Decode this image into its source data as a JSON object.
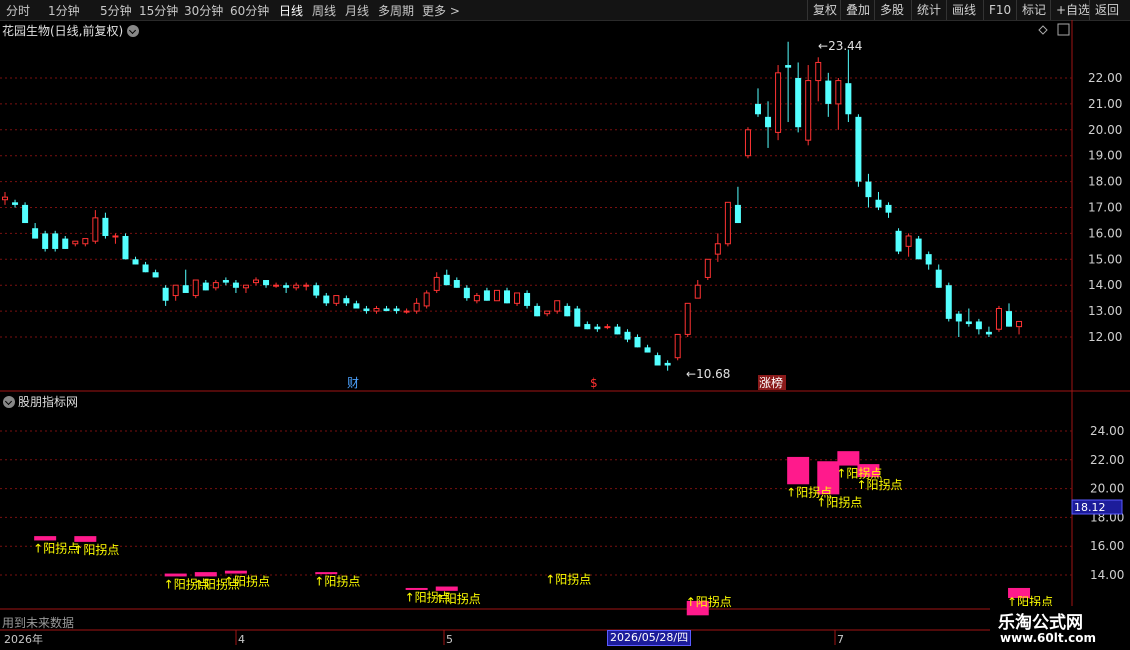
{
  "toolbar": {
    "periods": [
      "分时",
      "1分钟",
      "5分钟",
      "15分钟",
      "30分钟",
      "60分钟",
      "日线",
      "周线",
      "月线",
      "多周期",
      "更多 >"
    ],
    "active_period": "日线",
    "buttons": [
      "复权",
      "叠加",
      "多股",
      "统计",
      "画线",
      "F10",
      "标记",
      "+自选",
      "返回"
    ]
  },
  "main_chart": {
    "title": "花园生物(日线,前复权)",
    "high_label": "23.44",
    "low_label": "10.68",
    "price_ticks": [
      "22.00",
      "21.00",
      "20.00",
      "19.00",
      "18.00",
      "17.00",
      "16.00",
      "15.00",
      "14.00",
      "13.00",
      "12.00"
    ],
    "markers": [
      {
        "text": "财",
        "color": "#4da3ff"
      },
      {
        "text": "$",
        "color": "#ff3030"
      },
      {
        "text": "涨榜",
        "color": "#ffffff",
        "bg": "#8a1a1a"
      }
    ]
  },
  "sub_chart": {
    "title": "股朋指标网",
    "price_ticks": [
      "24.00",
      "22.00",
      "20.00",
      "18.00",
      "16.00",
      "14.00"
    ],
    "current_value": "18.12",
    "signal_label": "↑阳拐点",
    "note": "用到未来数据"
  },
  "time_axis": {
    "labels": [
      "2026年",
      "4",
      "5",
      "7"
    ],
    "cursor_date": "2026/05/28/四"
  },
  "watermark": {
    "line1": "乐淘公式网",
    "line2": "www.60lt.com"
  },
  "colors": {
    "up": "#ff3333",
    "down": "#54ffff",
    "grid": "#7a1010",
    "signal_box": "#ff1a8c",
    "signal_text": "#ffff00"
  },
  "chart_data": {
    "type": "candlestick",
    "ylim": [
      10.0,
      24.0
    ],
    "candles": [
      {
        "o": 17.3,
        "h": 17.6,
        "l": 17.1,
        "c": 17.4
      },
      {
        "o": 17.2,
        "h": 17.3,
        "l": 17.0,
        "c": 17.1
      },
      {
        "o": 17.1,
        "h": 17.2,
        "l": 16.4,
        "c": 16.4
      },
      {
        "o": 16.2,
        "h": 16.4,
        "l": 15.8,
        "c": 15.8
      },
      {
        "o": 16.0,
        "h": 16.1,
        "l": 15.3,
        "c": 15.4
      },
      {
        "o": 16.0,
        "h": 16.1,
        "l": 15.3,
        "c": 15.4
      },
      {
        "o": 15.8,
        "h": 15.9,
        "l": 15.4,
        "c": 15.4
      },
      {
        "o": 15.6,
        "h": 15.7,
        "l": 15.5,
        "c": 15.7
      },
      {
        "o": 15.6,
        "h": 15.8,
        "l": 15.5,
        "c": 15.8
      },
      {
        "o": 15.7,
        "h": 16.9,
        "l": 15.6,
        "c": 16.6
      },
      {
        "o": 16.6,
        "h": 16.8,
        "l": 15.8,
        "c": 15.9
      },
      {
        "o": 15.9,
        "h": 16.0,
        "l": 15.6,
        "c": 15.9
      },
      {
        "o": 15.9,
        "h": 16.0,
        "l": 15.0,
        "c": 15.0
      },
      {
        "o": 15.0,
        "h": 15.1,
        "l": 14.8,
        "c": 14.8
      },
      {
        "o": 14.8,
        "h": 14.9,
        "l": 14.5,
        "c": 14.5
      },
      {
        "o": 14.5,
        "h": 14.6,
        "l": 14.3,
        "c": 14.3
      },
      {
        "o": 13.9,
        "h": 14.0,
        "l": 13.2,
        "c": 13.4
      },
      {
        "o": 13.6,
        "h": 14.0,
        "l": 13.4,
        "c": 14.0
      },
      {
        "o": 14.0,
        "h": 14.6,
        "l": 13.8,
        "c": 13.7
      },
      {
        "o": 13.6,
        "h": 14.2,
        "l": 13.5,
        "c": 14.2
      },
      {
        "o": 14.1,
        "h": 14.2,
        "l": 13.8,
        "c": 13.8
      },
      {
        "o": 13.9,
        "h": 14.2,
        "l": 13.8,
        "c": 14.1
      },
      {
        "o": 14.2,
        "h": 14.3,
        "l": 14.0,
        "c": 14.1
      },
      {
        "o": 14.1,
        "h": 14.2,
        "l": 13.7,
        "c": 13.9
      },
      {
        "o": 13.9,
        "h": 14.0,
        "l": 13.7,
        "c": 14.0
      },
      {
        "o": 14.1,
        "h": 14.3,
        "l": 14.0,
        "c": 14.2
      },
      {
        "o": 14.2,
        "h": 14.2,
        "l": 13.9,
        "c": 14.0
      },
      {
        "o": 14.0,
        "h": 14.1,
        "l": 13.9,
        "c": 14.0
      },
      {
        "o": 14.0,
        "h": 14.1,
        "l": 13.7,
        "c": 13.9
      },
      {
        "o": 13.9,
        "h": 14.1,
        "l": 13.8,
        "c": 14.0
      },
      {
        "o": 14.0,
        "h": 14.1,
        "l": 13.8,
        "c": 14.0
      },
      {
        "o": 14.0,
        "h": 14.1,
        "l": 13.5,
        "c": 13.6
      },
      {
        "o": 13.6,
        "h": 13.7,
        "l": 13.2,
        "c": 13.3
      },
      {
        "o": 13.3,
        "h": 13.6,
        "l": 13.2,
        "c": 13.6
      },
      {
        "o": 13.5,
        "h": 13.6,
        "l": 13.2,
        "c": 13.3
      },
      {
        "o": 13.3,
        "h": 13.4,
        "l": 13.1,
        "c": 13.1
      },
      {
        "o": 13.1,
        "h": 13.2,
        "l": 12.9,
        "c": 13.0
      },
      {
        "o": 13.0,
        "h": 13.2,
        "l": 12.9,
        "c": 13.1
      },
      {
        "o": 13.1,
        "h": 13.2,
        "l": 13.0,
        "c": 13.0
      },
      {
        "o": 13.1,
        "h": 13.2,
        "l": 12.9,
        "c": 13.0
      },
      {
        "o": 13.0,
        "h": 13.1,
        "l": 12.9,
        "c": 13.0
      },
      {
        "o": 13.0,
        "h": 13.5,
        "l": 12.9,
        "c": 13.3
      },
      {
        "o": 13.2,
        "h": 13.8,
        "l": 13.1,
        "c": 13.7
      },
      {
        "o": 13.8,
        "h": 14.5,
        "l": 13.7,
        "c": 14.3
      },
      {
        "o": 14.4,
        "h": 14.6,
        "l": 14.0,
        "c": 14.0
      },
      {
        "o": 14.2,
        "h": 14.3,
        "l": 13.9,
        "c": 13.9
      },
      {
        "o": 13.9,
        "h": 14.0,
        "l": 13.4,
        "c": 13.5
      },
      {
        "o": 13.4,
        "h": 13.7,
        "l": 13.3,
        "c": 13.6
      },
      {
        "o": 13.8,
        "h": 13.9,
        "l": 13.4,
        "c": 13.4
      },
      {
        "o": 13.4,
        "h": 13.8,
        "l": 13.4,
        "c": 13.8
      },
      {
        "o": 13.8,
        "h": 13.9,
        "l": 13.3,
        "c": 13.3
      },
      {
        "o": 13.3,
        "h": 13.7,
        "l": 13.2,
        "c": 13.7
      },
      {
        "o": 13.7,
        "h": 13.8,
        "l": 13.1,
        "c": 13.2
      },
      {
        "o": 13.2,
        "h": 13.3,
        "l": 12.8,
        "c": 12.8
      },
      {
        "o": 12.9,
        "h": 13.0,
        "l": 12.8,
        "c": 13.0
      },
      {
        "o": 13.0,
        "h": 13.4,
        "l": 12.9,
        "c": 13.4
      },
      {
        "o": 13.2,
        "h": 13.3,
        "l": 12.8,
        "c": 12.8
      },
      {
        "o": 13.1,
        "h": 13.2,
        "l": 12.4,
        "c": 12.4
      },
      {
        "o": 12.5,
        "h": 12.6,
        "l": 12.3,
        "c": 12.3
      },
      {
        "o": 12.4,
        "h": 12.5,
        "l": 12.2,
        "c": 12.3
      },
      {
        "o": 12.4,
        "h": 12.5,
        "l": 12.3,
        "c": 12.4
      },
      {
        "o": 12.4,
        "h": 12.5,
        "l": 12.1,
        "c": 12.1
      },
      {
        "o": 12.2,
        "h": 12.3,
        "l": 11.8,
        "c": 11.9
      },
      {
        "o": 12.0,
        "h": 12.1,
        "l": 11.6,
        "c": 11.6
      },
      {
        "o": 11.6,
        "h": 11.7,
        "l": 11.4,
        "c": 11.4
      },
      {
        "o": 11.3,
        "h": 11.4,
        "l": 10.9,
        "c": 10.9
      },
      {
        "o": 11.0,
        "h": 11.1,
        "l": 10.7,
        "c": 10.9
      },
      {
        "o": 11.2,
        "h": 12.0,
        "l": 11.1,
        "c": 12.1
      },
      {
        "o": 12.1,
        "h": 13.3,
        "l": 12.0,
        "c": 13.3
      },
      {
        "o": 13.5,
        "h": 14.2,
        "l": 13.5,
        "c": 14.0
      },
      {
        "o": 14.3,
        "h": 15.0,
        "l": 14.2,
        "c": 15.0
      },
      {
        "o": 15.2,
        "h": 16.0,
        "l": 14.9,
        "c": 15.6
      },
      {
        "o": 15.6,
        "h": 17.1,
        "l": 15.5,
        "c": 17.2
      },
      {
        "o": 17.1,
        "h": 17.8,
        "l": 16.4,
        "c": 16.4
      },
      {
        "o": 19.0,
        "h": 20.1,
        "l": 18.9,
        "c": 20.0
      },
      {
        "o": 21.0,
        "h": 21.6,
        "l": 20.5,
        "c": 20.6
      },
      {
        "o": 20.5,
        "h": 21.1,
        "l": 19.3,
        "c": 20.1
      },
      {
        "o": 19.9,
        "h": 22.5,
        "l": 19.6,
        "c": 22.2
      },
      {
        "o": 22.5,
        "h": 23.4,
        "l": 20.3,
        "c": 22.4
      },
      {
        "o": 22.0,
        "h": 22.6,
        "l": 19.9,
        "c": 20.1
      },
      {
        "o": 19.6,
        "h": 22.5,
        "l": 19.4,
        "c": 21.9
      },
      {
        "o": 21.9,
        "h": 22.8,
        "l": 21.1,
        "c": 22.6
      },
      {
        "o": 21.9,
        "h": 22.2,
        "l": 20.5,
        "c": 21.0
      },
      {
        "o": 21.0,
        "h": 22.0,
        "l": 20.0,
        "c": 21.9
      },
      {
        "o": 21.8,
        "h": 23.1,
        "l": 20.3,
        "c": 20.6
      },
      {
        "o": 20.5,
        "h": 20.6,
        "l": 17.8,
        "c": 18.0
      },
      {
        "o": 18.0,
        "h": 18.3,
        "l": 17.0,
        "c": 17.4
      },
      {
        "o": 17.3,
        "h": 17.6,
        "l": 16.9,
        "c": 17.0
      },
      {
        "o": 17.1,
        "h": 17.2,
        "l": 16.6,
        "c": 16.8
      },
      {
        "o": 16.1,
        "h": 16.2,
        "l": 15.2,
        "c": 15.3
      },
      {
        "o": 15.5,
        "h": 16.0,
        "l": 15.1,
        "c": 15.9
      },
      {
        "o": 15.8,
        "h": 15.9,
        "l": 15.0,
        "c": 15.0
      },
      {
        "o": 15.2,
        "h": 15.3,
        "l": 14.6,
        "c": 14.8
      },
      {
        "o": 14.6,
        "h": 14.8,
        "l": 13.9,
        "c": 13.9
      },
      {
        "o": 14.0,
        "h": 14.1,
        "l": 12.6,
        "c": 12.7
      },
      {
        "o": 12.9,
        "h": 13.0,
        "l": 12.0,
        "c": 12.6
      },
      {
        "o": 12.6,
        "h": 13.1,
        "l": 12.4,
        "c": 12.5
      },
      {
        "o": 12.6,
        "h": 12.7,
        "l": 12.1,
        "c": 12.3
      },
      {
        "o": 12.2,
        "h": 12.4,
        "l": 12.0,
        "c": 12.1
      },
      {
        "o": 12.3,
        "h": 13.2,
        "l": 12.2,
        "c": 13.1
      },
      {
        "o": 13.0,
        "h": 13.3,
        "l": 12.4,
        "c": 12.4
      },
      {
        "o": 12.4,
        "h": 12.6,
        "l": 12.1,
        "c": 12.6
      }
    ],
    "signals": [
      {
        "i": 4,
        "top": 16.7,
        "bot": 16.4,
        "label": true
      },
      {
        "i": 8,
        "top": 16.7,
        "bot": 16.3,
        "label": true
      },
      {
        "i": 17,
        "top": 14.1,
        "bot": 13.9,
        "label": true
      },
      {
        "i": 20,
        "top": 14.2,
        "bot": 13.9,
        "label": true
      },
      {
        "i": 23,
        "top": 14.3,
        "bot": 14.1,
        "label": true
      },
      {
        "i": 32,
        "top": 14.2,
        "bot": 14.1,
        "label": true
      },
      {
        "i": 41,
        "top": 13.1,
        "bot": 13.0,
        "label": true
      },
      {
        "i": 44,
        "top": 13.2,
        "bot": 12.9,
        "label": true
      },
      {
        "i": 55,
        "top": null,
        "bot": null,
        "label": true
      },
      {
        "i": 69,
        "top": 12.2,
        "bot": 11.2,
        "label": true
      },
      {
        "i": 79,
        "top": 22.2,
        "bot": 20.3,
        "label": true
      },
      {
        "i": 82,
        "top": 21.9,
        "bot": 19.6,
        "label": true
      },
      {
        "i": 84,
        "top": 22.6,
        "bot": 21.6,
        "label": true
      },
      {
        "i": 86,
        "top": 21.7,
        "bot": 20.8,
        "label": true
      },
      {
        "i": 101,
        "top": 13.1,
        "bot": 12.4,
        "label": true
      }
    ]
  }
}
